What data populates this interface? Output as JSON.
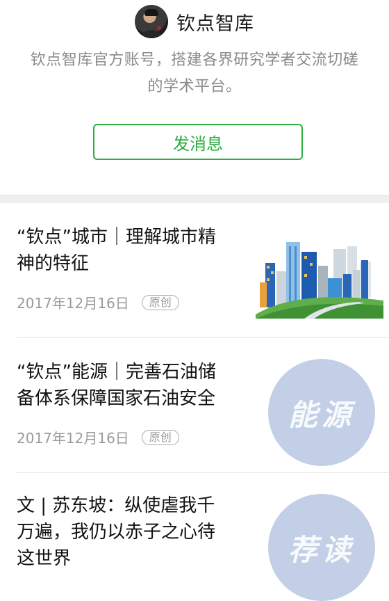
{
  "profile": {
    "name": "钦点智库",
    "description_line1": "钦点智库官方账号，搭建各界研究学者交流切磋",
    "description_line2": "的学术平台。",
    "send_button": "发消息"
  },
  "articles": [
    {
      "title_line1": "“钦点”城市｜理解城市精",
      "title_line2": "神的特征",
      "date": "2017年12月16日",
      "badge": "原创",
      "thumb_icon": "city-skyline-illustration"
    },
    {
      "title_line1": "“钦点”能源｜完善石油储",
      "title_line2": "备体系保障国家石油安全",
      "date": "2017年12月16日",
      "badge": "原创",
      "thumb_text": "能源",
      "thumb_color": "#c2cfe6"
    },
    {
      "title_line1": "文 | 苏东坡：纵使虐我千",
      "title_line2": "万遍，我仍以赤子之心待",
      "title_line3": "这世界",
      "thumb_text": "荐读",
      "thumb_color": "#c2cfe6"
    }
  ],
  "colors": {
    "accent_green": "#2aae40",
    "text_gray": "#8a8a8a",
    "background_gap": "#efefef"
  }
}
